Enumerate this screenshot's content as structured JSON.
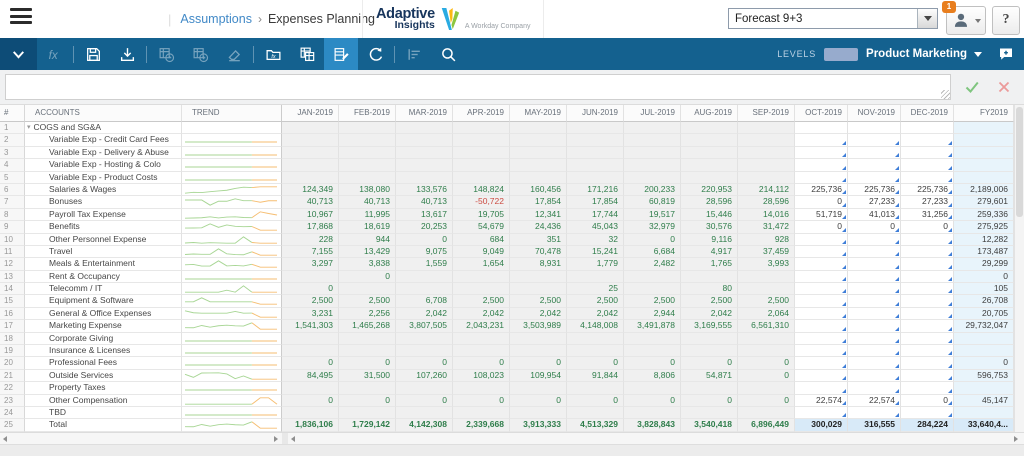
{
  "header": {
    "breadcrumb": {
      "divider": "|",
      "section": "Assumptions",
      "separator": "›",
      "page": "Expenses Planning"
    },
    "logo": {
      "line1": "Adaptive",
      "line2": "Insights",
      "tagline": "A Workday Company"
    },
    "version_select": {
      "value": "Forecast 9+3"
    },
    "user_menu": {
      "badge": "1"
    },
    "help_label": "?"
  },
  "toolbar": {
    "icons": [
      {
        "name": "collapse-toolbar-icon",
        "style": "dark"
      },
      {
        "name": "formula-icon",
        "disabled": true
      },
      {
        "name": "separator"
      },
      {
        "name": "save-icon"
      },
      {
        "name": "export-icon"
      },
      {
        "name": "separator"
      },
      {
        "name": "history-icon",
        "disabled": true
      },
      {
        "name": "snapshot-icon",
        "disabled": true
      },
      {
        "name": "eraser-icon",
        "disabled": true
      },
      {
        "name": "separator"
      },
      {
        "name": "folder-formula-icon"
      },
      {
        "name": "copy-sheet-icon"
      },
      {
        "name": "edit-sheet-icon",
        "active": true
      },
      {
        "name": "refresh-icon"
      },
      {
        "name": "separator"
      },
      {
        "name": "audit-icon",
        "disabled": true
      },
      {
        "name": "search-icon"
      }
    ],
    "levels_label": "LEVELS",
    "level_value": "Product Marketing"
  },
  "formula_bar": {
    "value": ""
  },
  "grid": {
    "columns": {
      "num": "#",
      "accounts": "ACCOUNTS",
      "trend": "TREND",
      "months": [
        "JAN-2019",
        "FEB-2019",
        "MAR-2019",
        "APR-2019",
        "MAY-2019",
        "JUN-2019",
        "JUL-2019",
        "AUG-2019",
        "SEP-2019",
        "OCT-2019",
        "NOV-2019",
        "DEC-2019"
      ],
      "fy": "FY2019"
    },
    "rows": [
      {
        "num": 1,
        "account": "COGS and SG&A",
        "level": 0,
        "expandable": true,
        "spark": false,
        "tri": false,
        "values": [
          "",
          "",
          "",
          "",
          "",
          "",
          "",
          "",
          "",
          "",
          "",
          ""
        ],
        "fy": ""
      },
      {
        "num": 2,
        "account": "Variable Exp - Credit Card Fees",
        "level": 1,
        "spark": true,
        "tri": true,
        "values": [
          "",
          "",
          "",
          "",
          "",
          "",
          "",
          "",
          "",
          "",
          "",
          ""
        ],
        "fy": ""
      },
      {
        "num": 3,
        "account": "Variable Exp - Delivery & Abuse",
        "level": 1,
        "spark": true,
        "tri": true,
        "values": [
          "",
          "",
          "",
          "",
          "",
          "",
          "",
          "",
          "",
          "",
          "",
          ""
        ],
        "fy": ""
      },
      {
        "num": 4,
        "account": "Variable Exp - Hosting & Colo",
        "level": 1,
        "spark": true,
        "tri": true,
        "values": [
          "",
          "",
          "",
          "",
          "",
          "",
          "",
          "",
          "",
          "",
          "",
          ""
        ],
        "fy": ""
      },
      {
        "num": 5,
        "account": "Variable Exp - Product Costs",
        "level": 1,
        "spark": true,
        "tri": true,
        "values": [
          "",
          "",
          "",
          "",
          "",
          "",
          "",
          "",
          "",
          "",
          "",
          ""
        ],
        "fy": ""
      },
      {
        "num": 6,
        "account": "Salaries & Wages",
        "level": 1,
        "spark": true,
        "tri": true,
        "values": [
          "124,349",
          "138,080",
          "133,576",
          "148,824",
          "160,456",
          "171,216",
          "200,233",
          "220,953",
          "214,112",
          "225,736",
          "225,736",
          "225,736"
        ],
        "fy": "2,189,006"
      },
      {
        "num": 7,
        "account": "Bonuses",
        "level": 1,
        "spark": true,
        "tri": true,
        "values": [
          "40,713",
          "40,713",
          "40,713",
          "-50,722",
          "17,854",
          "17,854",
          "60,819",
          "28,596",
          "28,596",
          "0",
          "27,233",
          "27,233"
        ],
        "fy": "279,601"
      },
      {
        "num": 8,
        "account": "Payroll Tax Expense",
        "level": 1,
        "spark": true,
        "tri": true,
        "values": [
          "10,967",
          "11,995",
          "13,617",
          "19,705",
          "12,341",
          "17,744",
          "19,517",
          "15,446",
          "14,016",
          "51,719",
          "41,013",
          "31,256"
        ],
        "fy": "259,336"
      },
      {
        "num": 9,
        "account": "Benefits",
        "level": 1,
        "spark": true,
        "tri": true,
        "values": [
          "17,868",
          "18,619",
          "20,253",
          "54,679",
          "24,436",
          "45,043",
          "32,979",
          "30,576",
          "31,472",
          "0",
          "0",
          "0"
        ],
        "fy": "275,925"
      },
      {
        "num": 10,
        "account": "Other Personnel Expense",
        "level": 1,
        "spark": true,
        "tri": true,
        "values": [
          "228",
          "944",
          "0",
          "684",
          "351",
          "32",
          "0",
          "9,116",
          "928",
          "",
          "",
          ""
        ],
        "fy": "12,282"
      },
      {
        "num": 11,
        "account": "Travel",
        "level": 1,
        "spark": true,
        "tri": true,
        "values": [
          "7,155",
          "13,429",
          "9,075",
          "9,049",
          "70,478",
          "15,241",
          "6,684",
          "4,917",
          "37,459",
          "",
          "",
          ""
        ],
        "fy": "173,487"
      },
      {
        "num": 12,
        "account": "Meals & Entertainment",
        "level": 1,
        "spark": true,
        "tri": true,
        "values": [
          "3,297",
          "3,838",
          "1,559",
          "1,654",
          "8,931",
          "1,779",
          "2,482",
          "1,765",
          "3,993",
          "",
          "",
          ""
        ],
        "fy": "29,299"
      },
      {
        "num": 13,
        "account": "Rent & Occupancy",
        "level": 1,
        "spark": true,
        "tri": true,
        "values": [
          "",
          "0",
          "",
          "",
          "",
          "",
          "",
          "",
          "",
          "",
          "",
          ""
        ],
        "fy": "0"
      },
      {
        "num": 14,
        "account": "Telecomm / IT",
        "level": 1,
        "spark": true,
        "tri": true,
        "values": [
          "0",
          "",
          "",
          "",
          "",
          "25",
          "",
          "80",
          "",
          "",
          "",
          ""
        ],
        "fy": "105"
      },
      {
        "num": 15,
        "account": "Equipment & Software",
        "level": 1,
        "spark": true,
        "tri": true,
        "values": [
          "2,500",
          "2,500",
          "6,708",
          "2,500",
          "2,500",
          "2,500",
          "2,500",
          "2,500",
          "2,500",
          "",
          "",
          ""
        ],
        "fy": "26,708"
      },
      {
        "num": 16,
        "account": "General & Office Expenses",
        "level": 1,
        "spark": true,
        "tri": true,
        "values": [
          "3,231",
          "2,256",
          "2,042",
          "2,042",
          "2,042",
          "2,042",
          "2,944",
          "2,042",
          "2,064",
          "",
          "",
          ""
        ],
        "fy": "20,705"
      },
      {
        "num": 17,
        "account": "Marketing Expense",
        "level": 1,
        "spark": true,
        "tri": true,
        "values": [
          "1,541,303",
          "1,465,268",
          "3,807,505",
          "2,043,231",
          "3,503,989",
          "4,148,008",
          "3,491,878",
          "3,169,555",
          "6,561,310",
          "",
          "",
          ""
        ],
        "fy": "29,732,047"
      },
      {
        "num": 18,
        "account": "Corporate Giving",
        "level": 1,
        "spark": true,
        "tri": true,
        "values": [
          "",
          "",
          "",
          "",
          "",
          "",
          "",
          "",
          "",
          "",
          "",
          ""
        ],
        "fy": ""
      },
      {
        "num": 19,
        "account": "Insurance & Licenses",
        "level": 1,
        "spark": true,
        "tri": true,
        "values": [
          "",
          "",
          "",
          "",
          "",
          "",
          "",
          "",
          "",
          "",
          "",
          ""
        ],
        "fy": ""
      },
      {
        "num": 20,
        "account": "Professional Fees",
        "level": 1,
        "spark": true,
        "tri": true,
        "values": [
          "0",
          "0",
          "0",
          "0",
          "0",
          "0",
          "0",
          "0",
          "0",
          "",
          "",
          ""
        ],
        "fy": "0"
      },
      {
        "num": 21,
        "account": "Outside Services",
        "level": 1,
        "spark": true,
        "tri": true,
        "values": [
          "84,495",
          "31,500",
          "107,260",
          "108,023",
          "109,954",
          "91,844",
          "8,806",
          "54,871",
          "0",
          "",
          "",
          ""
        ],
        "fy": "596,753"
      },
      {
        "num": 22,
        "account": "Property Taxes",
        "level": 1,
        "spark": true,
        "tri": true,
        "values": [
          "",
          "",
          "",
          "",
          "",
          "",
          "",
          "",
          "",
          "",
          "",
          ""
        ],
        "fy": ""
      },
      {
        "num": 23,
        "account": "Other Compensation",
        "level": 1,
        "spark": true,
        "tri": true,
        "values": [
          "0",
          "0",
          "0",
          "0",
          "0",
          "0",
          "0",
          "0",
          "0",
          "22,574",
          "22,574",
          "0"
        ],
        "fy": "45,147"
      },
      {
        "num": 24,
        "account": "TBD",
        "level": 1,
        "spark": true,
        "tri": true,
        "values": [
          "",
          "",
          "",
          "",
          "",
          "",
          "",
          "",
          "",
          "",
          "",
          ""
        ],
        "fy": ""
      },
      {
        "num": 25,
        "account": "Total",
        "level": 1,
        "spark": true,
        "tri": false,
        "total": true,
        "values": [
          "1,836,106",
          "1,729,142",
          "4,142,308",
          "2,339,668",
          "3,913,333",
          "4,513,329",
          "3,828,843",
          "3,540,418",
          "6,896,449",
          "300,029",
          "316,555",
          "284,224"
        ],
        "fy": "33,640,4..."
      }
    ]
  },
  "colors": {
    "toolbar_blue": "#14618F",
    "toolbar_active": "#2C8AC4",
    "toolbar_dark": "#0D4C77",
    "actual_green": "#2E7D4A",
    "negative_red": "#CC4B42",
    "forecast_fy_bg": "#E8F4FB",
    "total_highlight_bg": "#D8EAF8",
    "spark_actual": "#A8D695",
    "spark_forecast": "#F6BE72",
    "badge_orange": "#E87E1E",
    "link_blue": "#4189C7",
    "formula_check_green": "#7FC57F",
    "formula_cancel_red": "#EB9A9A"
  }
}
